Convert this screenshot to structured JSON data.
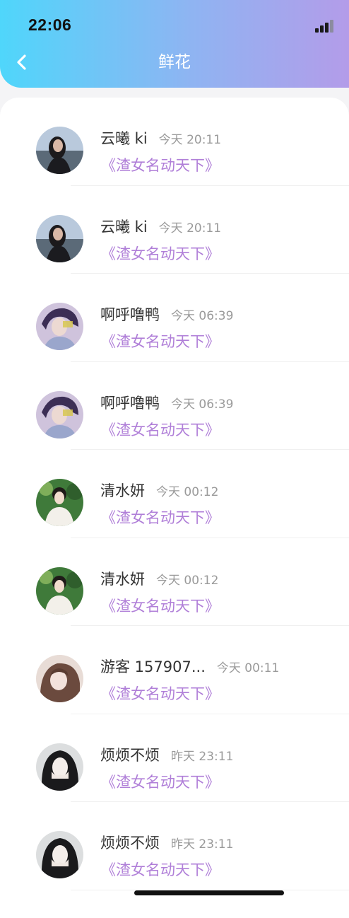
{
  "status_bar": {
    "time": "22:06"
  },
  "header": {
    "title": "鲜花"
  },
  "items": [
    {
      "name": "云曦 ki",
      "time": "今天 20:11",
      "subtitle": "《渣女名动天下》",
      "avatar": "avatar-a"
    },
    {
      "name": "云曦 ki",
      "time": "今天 20:11",
      "subtitle": "《渣女名动天下》",
      "avatar": "avatar-a"
    },
    {
      "name": "啊呼噜鸭",
      "time": "今天 06:39",
      "subtitle": "《渣女名动天下》",
      "avatar": "avatar-b"
    },
    {
      "name": "啊呼噜鸭",
      "time": "今天 06:39",
      "subtitle": "《渣女名动天下》",
      "avatar": "avatar-b"
    },
    {
      "name": "清水妍",
      "time": "今天 00:12",
      "subtitle": "《渣女名动天下》",
      "avatar": "avatar-c"
    },
    {
      "name": "清水妍",
      "time": "今天 00:12",
      "subtitle": "《渣女名动天下》",
      "avatar": "avatar-c"
    },
    {
      "name": "游客 157907...",
      "time": "今天 00:11",
      "subtitle": "《渣女名动天下》",
      "avatar": "avatar-d"
    },
    {
      "name": "烦烦不烦",
      "time": "昨天 23:11",
      "subtitle": "《渣女名动天下》",
      "avatar": "avatar-e"
    },
    {
      "name": "烦烦不烦",
      "time": "昨天 23:11",
      "subtitle": "《渣女名动天下》",
      "avatar": "avatar-e"
    }
  ],
  "colors": {
    "header_gradient": [
      "#4fd6fb",
      "#8fb4f2",
      "#b39ce9"
    ],
    "subtitle": "#b07fd8",
    "name": "#333333",
    "time": "#9a9a9a"
  }
}
